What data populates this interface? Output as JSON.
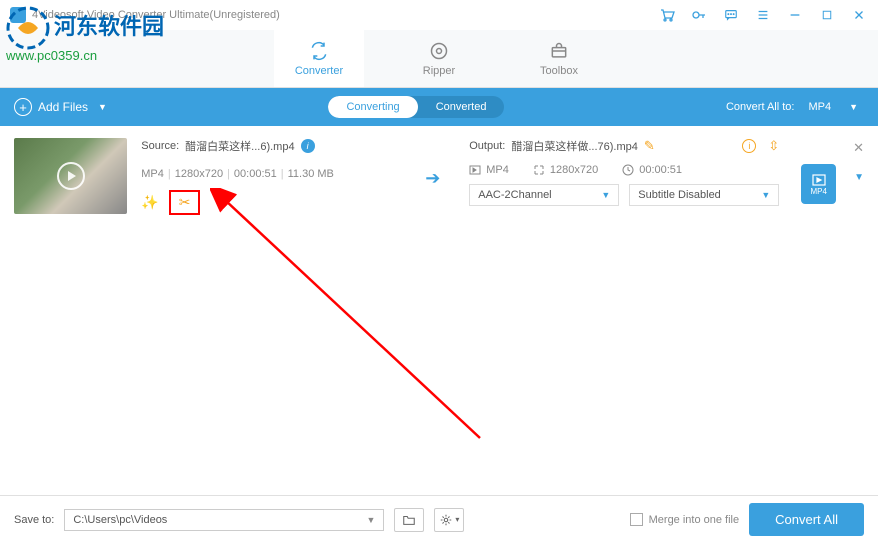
{
  "window": {
    "title": "4Videosoft Video Converter Ultimate(Unregistered)"
  },
  "watermark": {
    "text": "河东软件园",
    "url": "www.pc0359.cn"
  },
  "tabs": {
    "converter": "Converter",
    "ripper": "Ripper",
    "toolbox": "Toolbox"
  },
  "toolbar": {
    "add_files": "Add Files",
    "sub_converting": "Converting",
    "sub_converted": "Converted",
    "convert_all_label": "Convert All to:",
    "convert_all_value": "MP4"
  },
  "file": {
    "source_label": "Source:",
    "source_name": "醋溜白菜这样...6).mp4",
    "format": "MP4",
    "resolution": "1280x720",
    "duration": "00:00:51",
    "size": "11.30 MB",
    "output_label": "Output:",
    "output_name": "醋溜白菜这样做...76).mp4",
    "out_format": "MP4",
    "out_resolution": "1280x720",
    "out_duration": "00:00:51",
    "audio_select": "AAC-2Channel",
    "subtitle_select": "Subtitle Disabled",
    "badge_label": "MP4"
  },
  "bottom": {
    "save_label": "Save to:",
    "save_path": "C:\\Users\\pc\\Videos",
    "merge_label": "Merge into one file",
    "convert_btn": "Convert All"
  }
}
